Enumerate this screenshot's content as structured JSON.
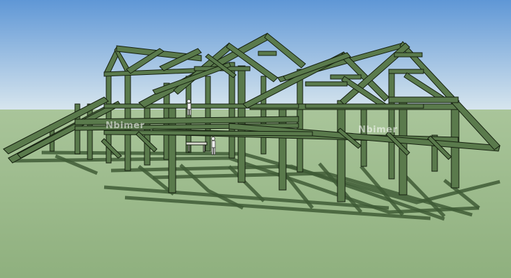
{
  "watermark": {
    "text": "Nbimer"
  },
  "colors": {
    "sky_top": "#5f97d6",
    "sky_bottom": "#d8e6ee",
    "ground": "#9dbb8c",
    "ground_far": "#a9c59a",
    "timber": "#5a7a4c",
    "timber_dark": "#3a5432",
    "outline": "#15200f",
    "shadow": "#3f5c36"
  }
}
